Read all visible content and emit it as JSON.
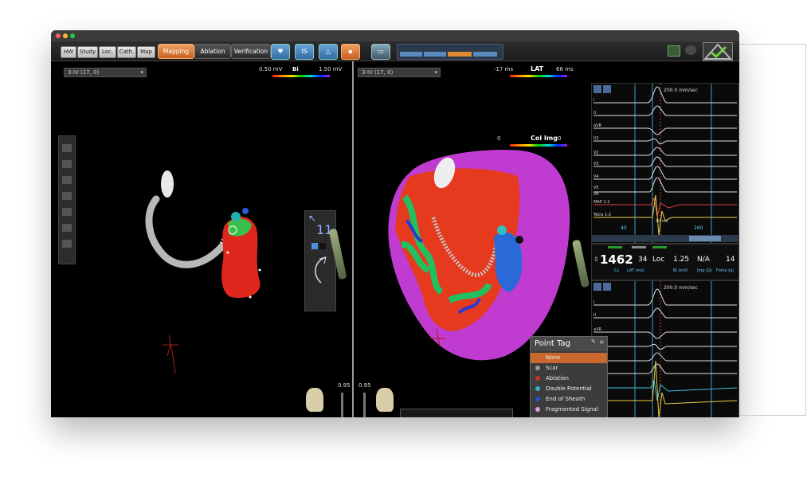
{
  "toolbar": {
    "tabs": [
      "HW",
      "Study",
      "Loc.",
      "Cath.",
      "Map"
    ],
    "modes": [
      "Mapping",
      "Ablation",
      "Verification"
    ],
    "is_label": "IS"
  },
  "left_view": {
    "view_select": "3-IV (17, 0)",
    "bar_min": "0.50 mV",
    "bar_title": "Bi",
    "bar_max": "1.50 mV",
    "orient_digits": "11",
    "slider_value": "0.95"
  },
  "right_view": {
    "view_select": "3-IV (17, 0)",
    "bar_min": "-17 ms",
    "bar_title": "LAT",
    "bar_max": "66 ms",
    "col_min": "0",
    "col_title": "Col Img",
    "col_max": "0",
    "slider_value": "0.95"
  },
  "ecg_top": {
    "speed": "200.0 mm/sec",
    "leads": [
      "I",
      "II",
      "aVR",
      "V1",
      "V2",
      "V3",
      "V4",
      "V5",
      "V6",
      "MAP 1-2",
      "Tetra 1-2"
    ],
    "tick_a": "40",
    "tick_b": "260",
    "marker": "10 ms"
  },
  "stats": {
    "cl_value": "1462",
    "cl_label": "CL",
    "lat_value": "34",
    "lat_label": "LAT (ms)",
    "loc_value": "Loc",
    "bi_value": "1.25",
    "bi_label": "Bi (mV)",
    "imp_value": "N/A",
    "imp_label": "Imp (Ω)",
    "force_value": "14",
    "force_label": "Force (g)"
  },
  "ecg_bottom": {
    "speed": "200.0 mm/sec",
    "leads": [
      "I",
      "II",
      "aVR",
      "V1"
    ]
  },
  "point_tag": {
    "title": "Point Tag",
    "options": [
      {
        "label": "None",
        "color": "#c0602a"
      },
      {
        "label": "Scar",
        "color": "#9a9a9a"
      },
      {
        "label": "Ablation",
        "color": "#d03020"
      },
      {
        "label": "Double Potential",
        "color": "#30b0c0"
      },
      {
        "label": "End of Sheath",
        "color": "#2050e0"
      },
      {
        "label": "Fragmented Signal",
        "color": "#e0a0e0"
      }
    ]
  },
  "colors": {
    "accent_orange": "#d9772b",
    "panel_dark": "#000000",
    "toolbar_dark": "#1f1f1f"
  }
}
